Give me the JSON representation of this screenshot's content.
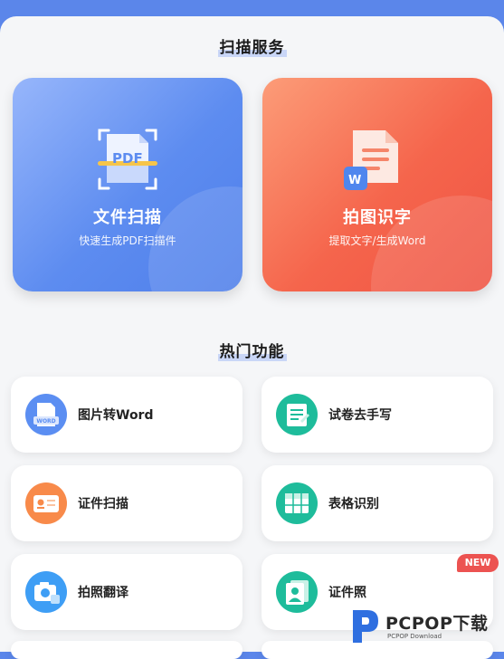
{
  "scan_section": {
    "title": "扫描服务",
    "cards": [
      {
        "title": "文件扫描",
        "subtitle": "快速生成PDF扫描件",
        "badge": "PDF",
        "icon": "document-scan-icon",
        "color": "#5d8cf0"
      },
      {
        "title": "拍图识字",
        "subtitle": "提取文字/生成Word",
        "badge": "W",
        "icon": "text-recognition-icon",
        "color": "#f5654c"
      }
    ]
  },
  "hot_section": {
    "title": "热门功能",
    "items": [
      {
        "label": "图片转Word",
        "icon": "image-to-word-icon",
        "icon_text": "WORD",
        "color": "#5b8ef2"
      },
      {
        "label": "试卷去手写",
        "icon": "exam-paper-icon",
        "color": "#1ebc9b"
      },
      {
        "label": "证件扫描",
        "icon": "id-card-scan-icon",
        "color": "#f88a4a"
      },
      {
        "label": "表格识别",
        "icon": "table-icon",
        "color": "#1ebc9b"
      },
      {
        "label": "拍照翻译",
        "icon": "camera-translate-icon",
        "color": "#3e9ef5"
      },
      {
        "label": "证件照",
        "icon": "id-photo-icon",
        "color": "#1ebc9b",
        "badge": "NEW"
      }
    ]
  },
  "watermark": {
    "brand": "PCPOP下载",
    "sub": "PCPOP Download"
  }
}
